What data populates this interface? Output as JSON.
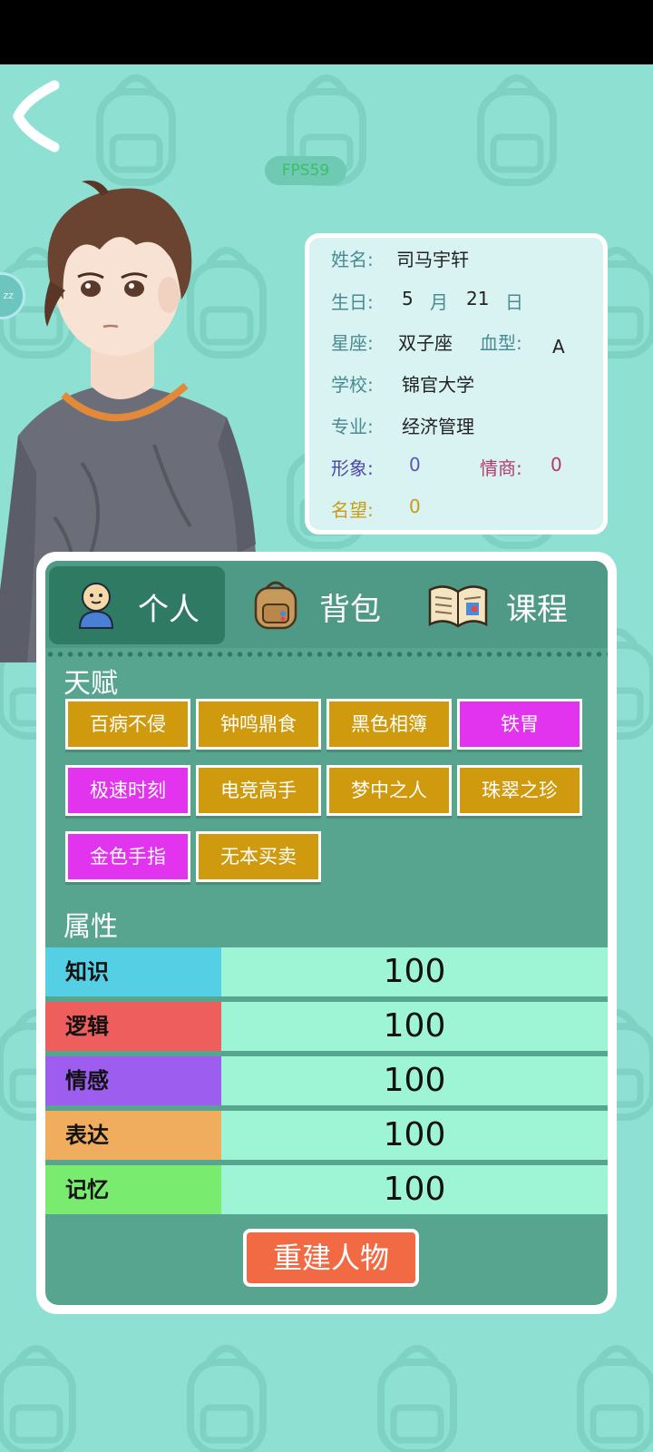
{
  "hud": {
    "fps": "FPS59",
    "side_badge": "zz"
  },
  "profile": {
    "name_label": "姓名:",
    "name": "司马宇轩",
    "birthday_label": "生日:",
    "birth_month": "5",
    "month_unit": "月",
    "birth_day": "21",
    "day_unit": "日",
    "zodiac_label": "星座:",
    "zodiac": "双子座",
    "blood_label": "血型:",
    "blood": "A",
    "school_label": "学校:",
    "school": "锦官大学",
    "major_label": "专业:",
    "major": "经济管理",
    "image_label": "形象:",
    "image": "0",
    "eq_label": "情商:",
    "eq": "0",
    "fame_label": "名望:",
    "fame": "0"
  },
  "tabs": [
    {
      "label": "个人",
      "active": true
    },
    {
      "label": "背包",
      "active": false
    },
    {
      "label": "课程",
      "active": false
    }
  ],
  "talents_title": "天赋",
  "talents": [
    {
      "label": "百病不侵",
      "color": "gold"
    },
    {
      "label": "钟鸣鼎食",
      "color": "gold"
    },
    {
      "label": "黑色相簿",
      "color": "gold"
    },
    {
      "label": "铁胃",
      "color": "pink"
    },
    {
      "label": "极速时刻",
      "color": "pink"
    },
    {
      "label": "电竞高手",
      "color": "gold"
    },
    {
      "label": "梦中之人",
      "color": "gold"
    },
    {
      "label": "珠翠之珍",
      "color": "gold"
    },
    {
      "label": "金色手指",
      "color": "pink"
    },
    {
      "label": "无本买卖",
      "color": "gold"
    }
  ],
  "attributes_title": "属性",
  "attributes": [
    {
      "label": "知识",
      "value": "100",
      "color": "#55cfe4"
    },
    {
      "label": "逻辑",
      "value": "100",
      "color": "#ee5e5c"
    },
    {
      "label": "情感",
      "value": "100",
      "color": "#9d5ef0"
    },
    {
      "label": "表达",
      "value": "100",
      "color": "#f0ad5e"
    },
    {
      "label": "记忆",
      "value": "100",
      "color": "#79ec6f"
    }
  ],
  "rebuild_label": "重建人物"
}
